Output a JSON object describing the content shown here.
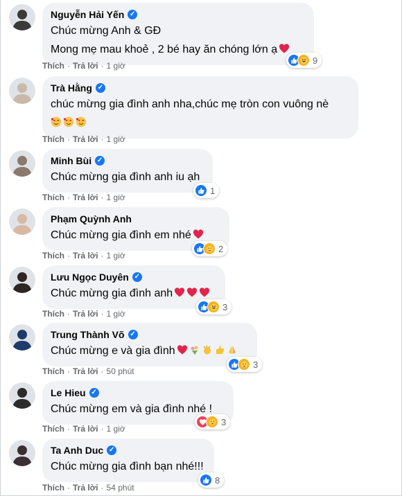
{
  "comments": [
    {
      "name": "Nguyễn Hải Yến",
      "verified": true,
      "lines": [
        "Chúc mừng Anh & GĐ",
        "Mong mẹ mau khoẻ , 2 bé hay ăn chóng lớn ạ"
      ],
      "emoji_after": [
        "heart"
      ],
      "reactions": [
        "like",
        "haha"
      ],
      "count": "9",
      "like": "Thích",
      "reply": "Trả lời",
      "sep": "·",
      "time": "1 giờ",
      "avatar_color": "#3a3a3a"
    },
    {
      "name": "Trà Hằng",
      "verified": true,
      "lines": [
        "chúc mừng gia đình anh nha,chúc mẹ tròn con vuông nè"
      ],
      "emoji_line": [
        "heart-eyes",
        "heart-eyes",
        "heart-eyes"
      ],
      "reactions": [],
      "count": "",
      "like": "Thích",
      "reply": "Trả lời",
      "sep": "·",
      "time": "1 giờ",
      "avatar_color": "#c9b9a8"
    },
    {
      "name": "Minh Bùi",
      "verified": true,
      "lines": [
        "Chúc mừng gia đình anh iu ạh"
      ],
      "reactions": [
        "like"
      ],
      "count": "1",
      "like": "Thích",
      "reply": "Trả lời",
      "sep": "·",
      "time": "1 giờ",
      "avatar_color": "#8a7a6d"
    },
    {
      "name": "Phạm Quỳnh Anh",
      "verified": false,
      "lines": [
        "Chúc mừng gia đình em nhé"
      ],
      "emoji_after": [
        "heart"
      ],
      "reactions": [
        "like",
        "care"
      ],
      "count": "2",
      "like": "Thích",
      "reply": "Trả lời",
      "sep": "·",
      "time": "1 giờ",
      "avatar_color": "#d9b8a3"
    },
    {
      "name": "Lưu Ngọc Duyên",
      "verified": true,
      "lines": [
        "Chúc mừng gia đình anh"
      ],
      "emoji_after": [
        "heart",
        "heart",
        "heart"
      ],
      "reactions": [
        "like",
        "haha"
      ],
      "count": "3",
      "like": "Thích",
      "reply": "Trả lời",
      "sep": "·",
      "time": "1 giờ",
      "avatar_color": "#2e2622"
    },
    {
      "name": "Trung Thành Võ",
      "verified": true,
      "lines": [
        "Chúc mừng e và gia đình"
      ],
      "emoji_after": [
        "heart",
        "bouquet",
        "clap",
        "thumbs",
        "pray"
      ],
      "reactions": [
        "like",
        "care"
      ],
      "count": "3",
      "like": "Thích",
      "reply": "Trả lời",
      "sep": "·",
      "time": "50 phút",
      "avatar_color": "#1f3b6b"
    },
    {
      "name": "Le Hieu",
      "verified": true,
      "lines": [
        "Chúc mừng em và gia đình nhé !"
      ],
      "reactions": [
        "love",
        "care"
      ],
      "count": "3",
      "like": "Thích",
      "reply": "Trả lời",
      "sep": "·",
      "time": "1 giờ",
      "avatar_color": "#2b2b2b"
    },
    {
      "name": "Ta Anh Duc",
      "verified": true,
      "lines": [
        "Chúc mừng gia đình bạn nhé!!!"
      ],
      "reactions": [
        "like"
      ],
      "count": "8",
      "like": "Thích",
      "reply": "Trả lời",
      "sep": "·",
      "time": "54 phút",
      "avatar_color": "#3b2f33"
    }
  ],
  "colors": {
    "bubble": "#f0f2f5",
    "meta": "#65676b",
    "like": "#1877f2",
    "love": "#f33e58",
    "care": "#f7b125"
  },
  "icons": {
    "verified": "verified-check-icon",
    "like": "like-icon",
    "love": "love-icon",
    "care": "care-icon",
    "haha": "haha-icon"
  }
}
